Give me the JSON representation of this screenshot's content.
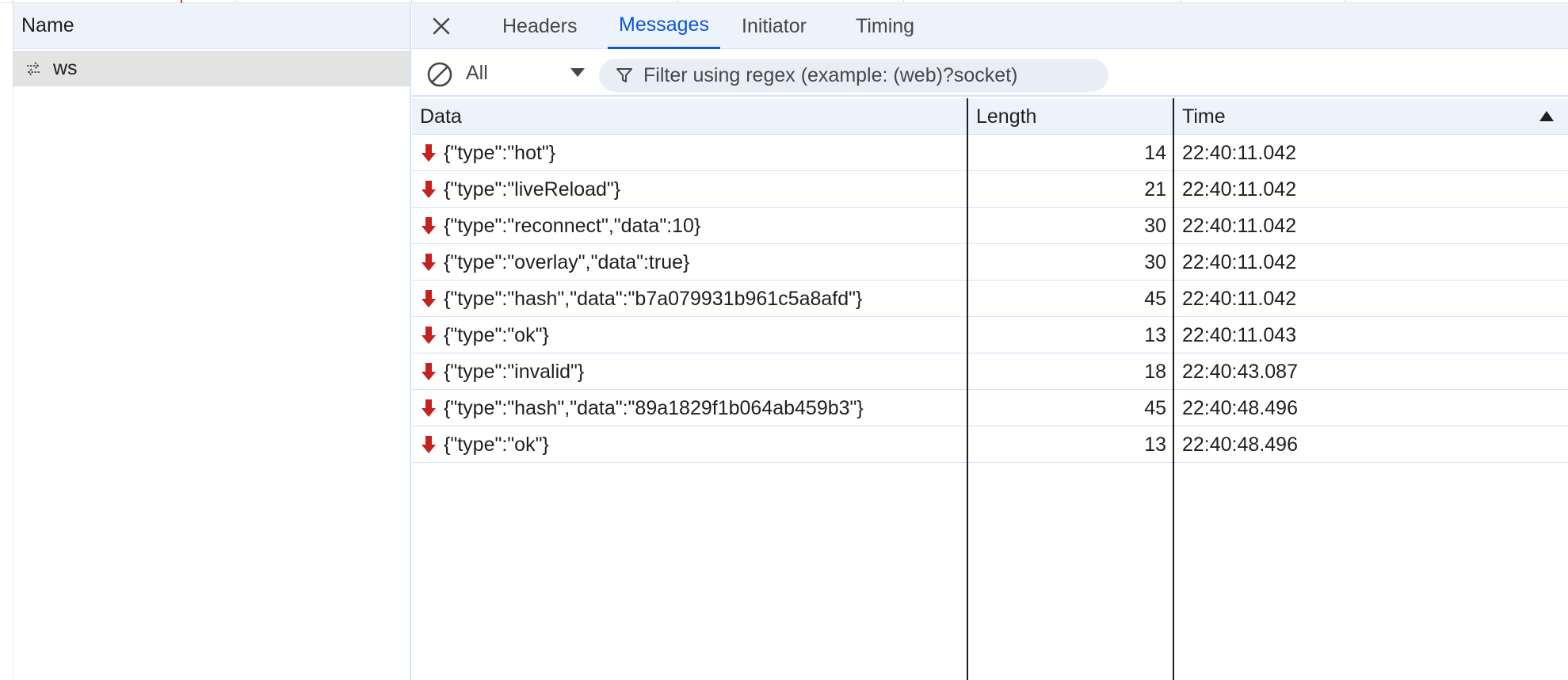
{
  "left_panel": {
    "header": "Name",
    "requests": [
      {
        "name": "ws",
        "icon": "websocket-icon"
      }
    ]
  },
  "tabs": {
    "close_icon": "close-icon",
    "items": [
      {
        "label": "Headers",
        "active": false
      },
      {
        "label": "Messages",
        "active": true
      },
      {
        "label": "Initiator",
        "active": false
      },
      {
        "label": "Timing",
        "active": false
      }
    ]
  },
  "toolbar": {
    "clear_icon": "clear-block-icon",
    "filter_select": "All",
    "filter_placeholder": "Filter using regex (example: (web)?socket)",
    "filter_icon": "funnel-icon"
  },
  "grid": {
    "columns": {
      "data": "Data",
      "length": "Length",
      "time": "Time"
    },
    "sort": {
      "column": "Time",
      "direction": "ascending"
    },
    "rows": [
      {
        "direction": "received",
        "data": "{\"type\":\"hot\"}",
        "length": "14",
        "time": "22:40:11.042"
      },
      {
        "direction": "received",
        "data": "{\"type\":\"liveReload\"}",
        "length": "21",
        "time": "22:40:11.042"
      },
      {
        "direction": "received",
        "data": "{\"type\":\"reconnect\",\"data\":10}",
        "length": "30",
        "time": "22:40:11.042"
      },
      {
        "direction": "received",
        "data": "{\"type\":\"overlay\",\"data\":true}",
        "length": "30",
        "time": "22:40:11.042"
      },
      {
        "direction": "received",
        "data": "{\"type\":\"hash\",\"data\":\"b7a079931b961c5a8afd\"}",
        "length": "45",
        "time": "22:40:11.042"
      },
      {
        "direction": "received",
        "data": "{\"type\":\"ok\"}",
        "length": "13",
        "time": "22:40:11.043"
      },
      {
        "direction": "received",
        "data": "{\"type\":\"invalid\"}",
        "length": "18",
        "time": "22:40:43.087"
      },
      {
        "direction": "received",
        "data": "{\"type\":\"hash\",\"data\":\"89a1829f1b064ab459b3\"}",
        "length": "45",
        "time": "22:40:48.496"
      },
      {
        "direction": "received",
        "data": "{\"type\":\"ok\"}",
        "length": "13",
        "time": "22:40:48.496"
      }
    ]
  },
  "colors": {
    "accent": "#0b57d0",
    "received_arrow": "#c5221f",
    "header_bg": "#eef3fb",
    "selected_row": "#e3e3e3"
  }
}
